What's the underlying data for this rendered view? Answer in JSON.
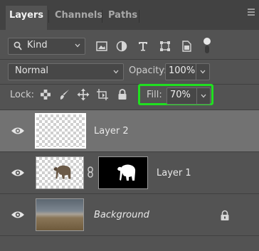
{
  "tabs": [
    {
      "label": "Layers",
      "active": true
    },
    {
      "label": "Channels",
      "active": false
    },
    {
      "label": "Paths",
      "active": false
    }
  ],
  "filter": {
    "kind_label": "Kind",
    "icons": [
      "pixel-layer-filter-icon",
      "adjustment-layer-filter-icon",
      "type-layer-filter-icon",
      "shape-layer-filter-icon",
      "smart-object-filter-icon",
      "filter-toggle-icon"
    ]
  },
  "blend": {
    "mode": "Normal",
    "opacity_label": "Opacity:",
    "opacity_value": "100%"
  },
  "lock": {
    "label": "Lock:",
    "icons": [
      "lock-transparent-pixels-icon",
      "lock-image-pixels-icon",
      "lock-position-icon",
      "lock-artboard-icon",
      "lock-all-icon"
    ],
    "fill_label": "Fill:",
    "fill_value": "70%"
  },
  "layers": [
    {
      "name": "Layer 2",
      "selected": true,
      "visible": true
    },
    {
      "name": "Layer 1",
      "selected": false,
      "visible": true,
      "has_mask": true
    },
    {
      "name": "Background",
      "selected": false,
      "visible": true,
      "locked": true
    }
  ],
  "colors": {
    "panel_bg": "#535353",
    "tab_bar_bg": "#424242",
    "selected_row_bg": "#727272",
    "highlight_green": "#20e020"
  }
}
